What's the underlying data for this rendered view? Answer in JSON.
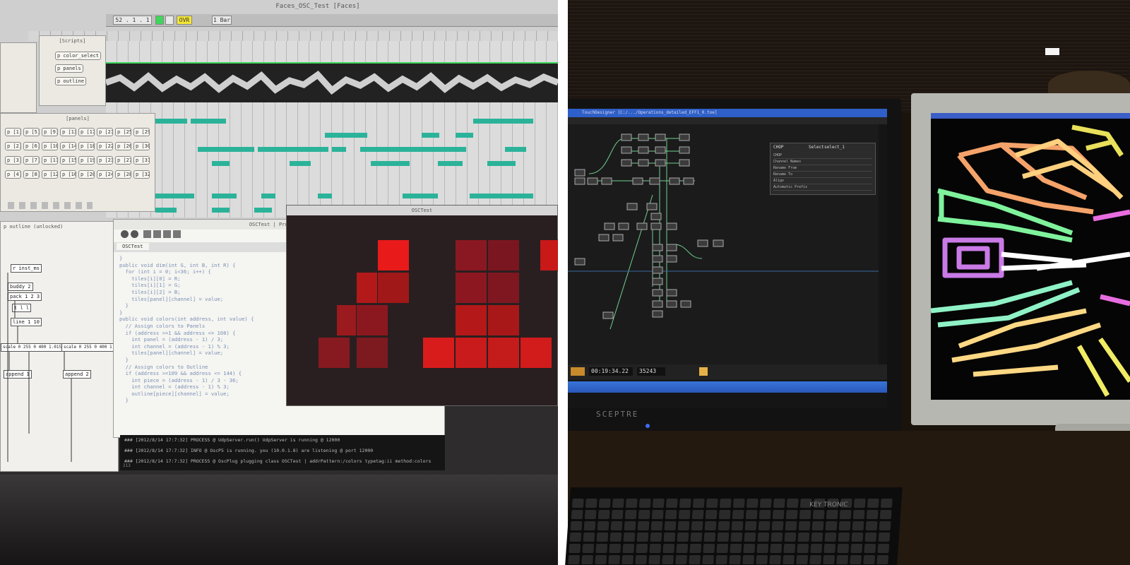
{
  "left_photo": {
    "daw_window_title": "Faces_OSC_Test [Faces]",
    "toolbar": {
      "position": "52 . 1 . 1",
      "ovr_label": "OVR",
      "bar_label": "1 Bar"
    },
    "popup_top": {
      "title": "[Scripts]",
      "buttons": [
        "p color_select",
        "p panels",
        "p outline"
      ]
    },
    "popup_panels": {
      "title": "[panels]",
      "rows": [
        [
          "p [1]",
          "p [5]",
          "p [9]",
          "p [13]",
          "p [17]",
          "p [21]",
          "p [25]",
          "p [29]"
        ],
        [
          "p [2]",
          "p [6]",
          "p [10]",
          "p [14]",
          "p [18]",
          "p [22]",
          "p [26]",
          "p [30]"
        ],
        [
          "p [3]",
          "p [7]",
          "p [11]",
          "p [15]",
          "p [19]",
          "p [23]",
          "p [27]",
          "p [31]"
        ],
        [
          "p [4]",
          "p [8]",
          "p [12]",
          "p [16]",
          "p [20]",
          "p [24]",
          "p [28]",
          "p [32]"
        ]
      ]
    },
    "patcher": {
      "title": "p outline (unlocked)",
      "objects": [
        "r inst_ms",
        "buddy 2",
        "pack 1 2 3",
        "t l l",
        "line 1 10",
        "scale 0 255 0 400 1.015",
        "scale 0 255 0 400 1.015",
        "append 1",
        "append 2"
      ]
    },
    "code_editor": {
      "window_title": "OSCTest | Processing",
      "tab": "OSCTest",
      "lines": [
        "}",
        "",
        "public void dim(int G, int B, int R) {",
        "  for (int i = 0; i<36; i++) {",
        "    tiles[i][0] = R;",
        "    tiles[i][1] = G;",
        "    tiles[i][2] = B;",
        "    tiles[panel][channel] = value;",
        "  }",
        "}",
        "",
        "public void colors(int address, int value) {",
        "",
        "  // Assign colors to Panels",
        "  if (address >=1 && address <= 108) {",
        "    int panel = (address - 1) / 3;",
        "    int channel = (address - 1) % 3;",
        "    tiles[panel][channel] = value;",
        "  }",
        "  // Assign colors to Outline",
        "  if (address >=109 && address <= 144) {",
        "    int piece = (address - 1) / 3 - 36;",
        "    int channel = (address - 1) % 3;",
        "    outline[piece][channel] = value;",
        "  }"
      ],
      "console_lines": [
        "### [2012/8/14 17:7:32] PROCESS @ UdpServer.run() UdpServer is running @ 12000",
        "### [2012/8/14 17:7:32] INFO @ OscP5 is running. you (10.0.1.8) are listening @ port 12000",
        "### [2012/8/14 17:7:32] PROCESS @ OscPlug plugging class OSCTest | addrPattern:/colors typetag:ii method:colors"
      ],
      "status": "213"
    },
    "osc_window_title": "OSCTest"
  },
  "right_photo": {
    "touchdesigner": {
      "window_title": "TouchDesigner  [C:/.../Operations_detailed_EFF1_0.toe]",
      "timecode": "00:19:34.22",
      "frame": "35243",
      "panel": {
        "op_label": "CHOP",
        "select_label": "Select",
        "select_value": "select_1",
        "rows": [
          "CHOP",
          "Channel Names",
          "Rename From",
          "Rename To",
          "Align",
          "Automatic Prefix"
        ]
      }
    },
    "monitor_brand": "SCEPTRE",
    "keyboard_brand": "KEY TRONIC"
  },
  "colors": {
    "note_teal": "#2bb39a",
    "progress_green": "#3fd65b",
    "tile_red": "#d41c1c",
    "monitor_blue": "#2f5fc8"
  }
}
